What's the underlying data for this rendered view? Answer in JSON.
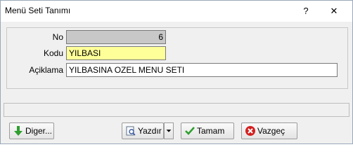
{
  "window": {
    "title": "Menü Seti Tanımı",
    "help_glyph": "?",
    "close_glyph": "✕"
  },
  "form": {
    "no": {
      "label": "No",
      "value": "6"
    },
    "kodu": {
      "label": "Kodu",
      "value": "YILBASI"
    },
    "aciklama": {
      "label": "Açiklama",
      "value": "YILBASINA OZEL MENU SETI"
    }
  },
  "status": {
    "text": ""
  },
  "buttons": {
    "diger": {
      "label": "Diger...",
      "icon": "green-down-arrow-icon"
    },
    "yazdir": {
      "label": "Yazdır",
      "icon": "print-preview-icon"
    },
    "tamam": {
      "label": "Tamam",
      "icon": "green-check-icon"
    },
    "vazgec": {
      "label": "Vazgeç",
      "icon": "red-cancel-icon"
    }
  },
  "colors": {
    "kodu_bg": "#ffff99",
    "no_bg": "#c8c8c8",
    "accent_green": "#2e9e2e",
    "accent_red": "#d42020"
  }
}
